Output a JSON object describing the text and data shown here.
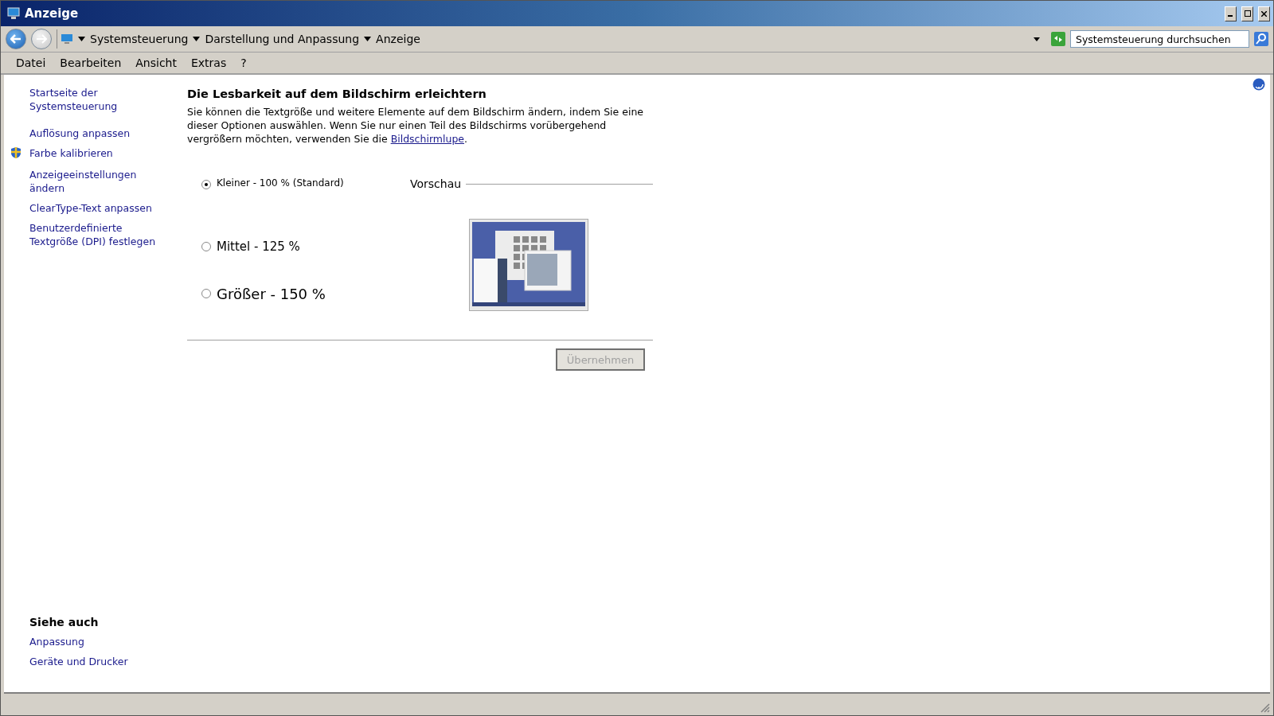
{
  "window": {
    "title": "Anzeige"
  },
  "address_bar": {
    "breadcrumbs": [
      "Systemsteuerung",
      "Darstellung und Anpassung",
      "Anzeige"
    ]
  },
  "search": {
    "placeholder": "Systemsteuerung durchsuchen"
  },
  "menu": [
    "Datei",
    "Bearbeiten",
    "Ansicht",
    "Extras",
    "?"
  ],
  "sidebar": {
    "items": [
      {
        "label": "Startseite der Systemsteuerung",
        "kind": "link"
      },
      {
        "label": "Auflösung anpassen",
        "kind": "link"
      },
      {
        "label": "Farbe kalibrieren",
        "kind": "shield"
      },
      {
        "label": "Anzeigeeinstellungen ändern",
        "kind": "link"
      },
      {
        "label": "ClearType-Text anpassen",
        "kind": "link"
      },
      {
        "label": "Benutzerdefinierte Textgröße (DPI) festlegen",
        "kind": "link"
      }
    ],
    "see_also": {
      "title": "Siehe auch",
      "items": [
        "Anpassung",
        "Geräte und Drucker"
      ]
    }
  },
  "main": {
    "heading": "Die Lesbarkeit auf dem Bildschirm erleichtern",
    "description": "Sie können die Textgröße und weitere Elemente auf dem Bildschirm ändern, indem Sie eine dieser Optionen auswählen. Wenn Sie nur einen Teil des Bildschirms vorübergehend vergrößern möchten, verwenden Sie die",
    "link": "Bildschirmlupe",
    "description_end": ".",
    "options": [
      {
        "label": "Kleiner - 100 % (Standard)",
        "selected": true
      },
      {
        "label": "Mittel - 125 %",
        "selected": false
      },
      {
        "label": "Größer - 150 %",
        "selected": false
      }
    ],
    "preview_label": "Vorschau",
    "apply_button": {
      "label": "Übernehmen",
      "disabled": true
    }
  }
}
